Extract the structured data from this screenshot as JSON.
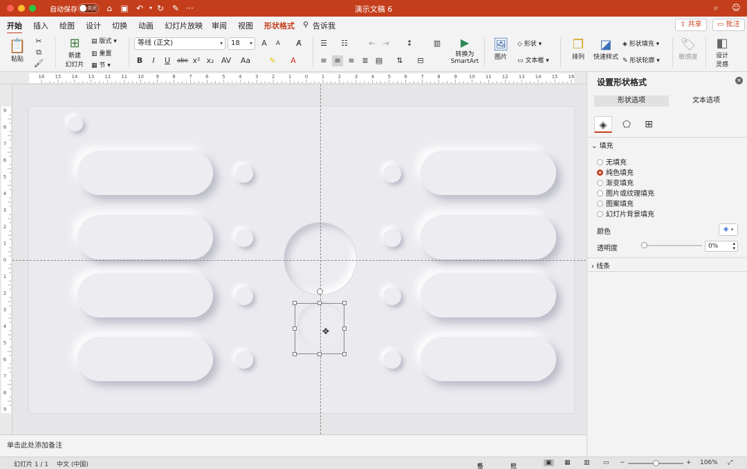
{
  "titlebar": {
    "autosave_label": "自动保存",
    "autosave_state": "关闭",
    "doc_title": "演示文稿 6",
    "more": "···"
  },
  "tabs": [
    "开始",
    "插入",
    "绘图",
    "设计",
    "切换",
    "动画",
    "幻灯片放映",
    "审阅",
    "视图",
    "形状格式"
  ],
  "tell_me": "告诉我",
  "share_label": "共享",
  "comment_label": "批注",
  "ribbon": {
    "paste": "粘贴",
    "new_slide_l1": "新建",
    "new_slide_l2": "幻灯片",
    "layout": "版式",
    "reset": "重置",
    "section": "节",
    "font_name": "等线 (正文)",
    "font_size": "18",
    "bold": "B",
    "italic": "I",
    "underline": "U",
    "strike": "abc",
    "superscript": "x²",
    "subscript": "x₂",
    "char_spacing": "AV",
    "change_case": "Aa",
    "grow_font": "A",
    "shrink_font": "A",
    "convert_l1": "转换为",
    "convert_l2": "SmartArt",
    "picture": "图片",
    "shapes": "形状",
    "textbox": "文本框",
    "arrange": "排列",
    "quick_styles": "快速样式",
    "shape_fill": "形状填充",
    "shape_outline": "形状轮廓",
    "sensitivity": "敏感度",
    "designer_l1": "设计",
    "designer_l2": "灵感"
  },
  "ruler": {
    "top_ticks": [
      "16",
      "15",
      "14",
      "13",
      "12",
      "11",
      "10",
      "9",
      "8",
      "7",
      "6",
      "5",
      "4",
      "3",
      "2",
      "1",
      "0",
      "1",
      "2",
      "3",
      "4",
      "5",
      "6",
      "7",
      "8",
      "9",
      "10",
      "11",
      "12",
      "13",
      "14",
      "15",
      "16"
    ],
    "left_ticks": [
      "9",
      "8",
      "7",
      "6",
      "5",
      "4",
      "3",
      "2",
      "1",
      "0",
      "1",
      "2",
      "3",
      "4",
      "5",
      "6",
      "7",
      "8",
      "9"
    ]
  },
  "notes_placeholder": "单击此处添加备注",
  "pane": {
    "title": "设置形状格式",
    "tab_shape": "形状选项",
    "tab_text": "文本选项",
    "fill_header": "填充",
    "fill_options": [
      "无填充",
      "纯色填充",
      "渐变填充",
      "图片或纹理填充",
      "图案填充",
      "幻灯片背景填充"
    ],
    "selected_fill": 1,
    "color_label": "颜色",
    "transparency_label": "透明度",
    "transparency_value": "0%",
    "transparency_fraction": 0,
    "line_header": "线条"
  },
  "status": {
    "slide_counter": "幻灯片 1 / 1",
    "language": "中文 (中国)",
    "notes": "备注",
    "comments": "批注",
    "zoom": "106%"
  }
}
